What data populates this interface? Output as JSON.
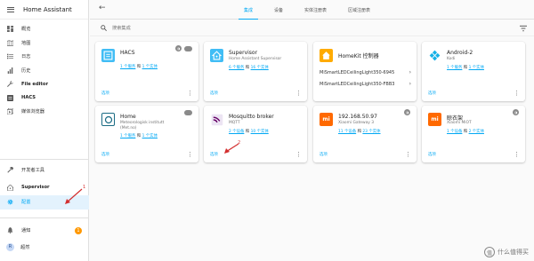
{
  "app": {
    "title": "Home Assistant"
  },
  "sidebar": {
    "items": [
      {
        "label": "概览",
        "icon": "view-dashboard-icon"
      },
      {
        "label": "地图",
        "icon": "map-icon"
      },
      {
        "label": "日志",
        "icon": "logbook-icon"
      },
      {
        "label": "历史",
        "icon": "history-icon"
      },
      {
        "label": "File editor",
        "icon": "wrench-icon"
      },
      {
        "label": "HACS",
        "icon": "hacs-icon"
      },
      {
        "label": "媒体浏览器",
        "icon": "media-icon"
      }
    ],
    "dev_tools": "开发者工具",
    "supervisor": "Supervisor",
    "config": "配置",
    "notifications": "通知",
    "notification_count": "1",
    "user": "超然",
    "user_initial": "R"
  },
  "topbar": {
    "tabs": [
      {
        "label": "集成",
        "active": true
      },
      {
        "label": "设备",
        "active": false
      },
      {
        "label": "实体注册表",
        "active": false
      },
      {
        "label": "区域注册表",
        "active": false
      }
    ]
  },
  "search": {
    "placeholder": "搜索集成"
  },
  "cards": [
    {
      "title": "HACS",
      "sub": [],
      "links": [
        "1 个服务",
        "1 个实体"
      ],
      "foot": "选项",
      "logo_color": "#41bdf5"
    },
    {
      "title": "Supervisor",
      "sub": [
        "Home Assistant Supervisor"
      ],
      "links": [
        "6 个服务",
        "16 个实体"
      ],
      "foot": "选项",
      "logo_color": "#41bdf5"
    },
    {
      "title": "HomeKit 控制器",
      "rows": [
        "MiSmartLEDCeilingLight350-6945",
        "MiSmartLEDCeilingLight350-FBB3"
      ],
      "logo_color": "#ffab00"
    },
    {
      "title": "Android-2",
      "sub": [
        "Kodi"
      ],
      "links": [
        "1 个服务",
        "1 个实体"
      ],
      "foot": "选项",
      "logo_color": "#ffffff"
    },
    {
      "title": "Home",
      "sub": [
        "Meteorologisk institutt",
        "(Met.no)"
      ],
      "links": [
        "1 个服务",
        "1 个实体"
      ],
      "foot": "选项",
      "logo_color": "#ffffff"
    },
    {
      "title": "Mosquitto broker",
      "sub": [
        "MQTT"
      ],
      "links": [
        "2 个设备",
        "10 个实体"
      ],
      "foot": "选项",
      "logo_color": "#ffffff"
    },
    {
      "title": "192.168.50.97",
      "sub": [
        "Xiaomi Gateway 3"
      ],
      "links": [
        "11 个设备",
        "23 个实体"
      ],
      "foot": "选项",
      "logo_color": "#ff6900"
    },
    {
      "title": "晾衣架",
      "sub": [
        "Xiaomi MiOT"
      ],
      "links": [
        "1 个设备",
        "2 个实体"
      ],
      "foot": "选项",
      "logo_color": "#ff6900"
    }
  ],
  "link_joiner": "和",
  "annotations": {
    "one": "1",
    "two": "2"
  },
  "watermark": {
    "mark": "值",
    "text": "什么值得买"
  },
  "colors": {
    "accent": "#03a9f4",
    "annotation": "#d32f2f",
    "xiaomi": "#ff6900"
  }
}
